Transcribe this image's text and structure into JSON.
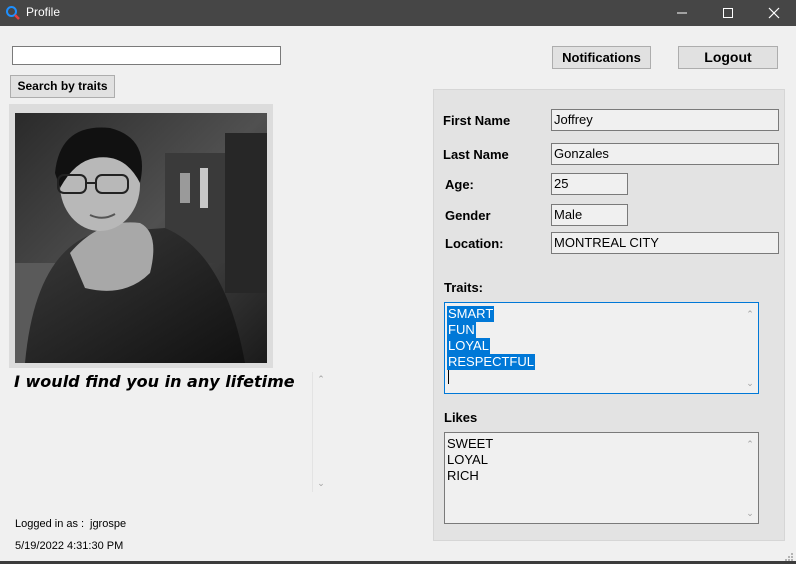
{
  "window": {
    "title": "Profile",
    "accent": "#0078d7"
  },
  "search": {
    "value": "",
    "button_label": "Search by traits"
  },
  "top_buttons": {
    "notifications_label": "Notifications",
    "logout_label": "Logout"
  },
  "bio": {
    "text": "I would find you in any lifetime"
  },
  "footer": {
    "logged_in_label": "Logged in as :",
    "username": "jgrospe",
    "timestamp": "5/19/2022 4:31:30 PM"
  },
  "profile": {
    "first_name_label": "First Name",
    "first_name": "Joffrey",
    "last_name_label": "Last Name",
    "last_name": "Gonzales",
    "age_label": "Age:",
    "age": "25",
    "gender_label": "Gender",
    "gender": "Male",
    "location_label": "Location:",
    "location": "MONTREAL CITY"
  },
  "traits": {
    "label": "Traits:",
    "items": [
      "SMART",
      "FUN",
      "LOYAL",
      "RESPECTFUL"
    ]
  },
  "likes": {
    "label": "Likes",
    "items": [
      "SWEET",
      "LOYAL",
      "RICH"
    ]
  }
}
